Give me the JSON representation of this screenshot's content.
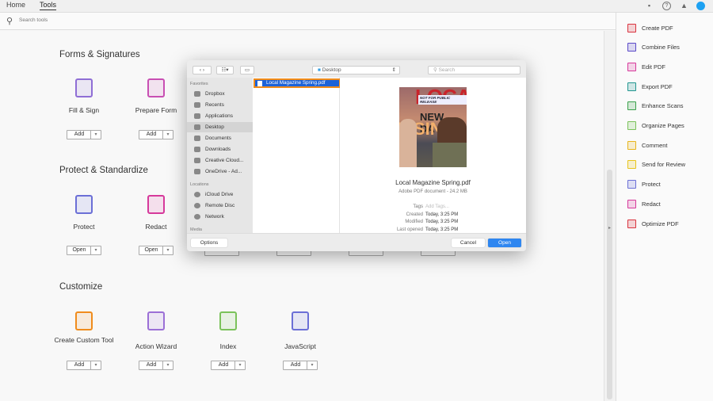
{
  "topbar": {
    "tabs": [
      "Home",
      "Tools"
    ],
    "active": "Tools"
  },
  "search": {
    "placeholder": "Search tools"
  },
  "sections": [
    {
      "title": "Forms & Signatures",
      "tools": [
        {
          "label": "Fill & Sign",
          "button": "Add",
          "icon": "fill-sign-icon",
          "color": "#8f6ed5"
        },
        {
          "label": "Prepare Form",
          "button": "Add",
          "icon": "prepare-form-icon",
          "color": "#c84fb3"
        }
      ]
    },
    {
      "title": "Protect & Standardize",
      "tools": [
        {
          "label": "Protect",
          "button": "Open",
          "icon": "shield-icon",
          "color": "#6b6fd6"
        },
        {
          "label": "Redact",
          "button": "Open",
          "icon": "redact-icon",
          "color": "#d6399b"
        }
      ]
    },
    {
      "title": "Customize",
      "tools": [
        {
          "label": "Create Custom Tool",
          "button": "Add",
          "icon": "custom-tool-icon",
          "color": "#f08c1c"
        },
        {
          "label": "Action Wizard",
          "button": "Add",
          "icon": "action-wizard-icon",
          "color": "#9b6fd6"
        },
        {
          "label": "Index",
          "button": "Add",
          "icon": "index-icon",
          "color": "#7ac25a"
        },
        {
          "label": "JavaScript",
          "button": "Add",
          "icon": "javascript-icon",
          "color": "#6b6fd6"
        }
      ]
    }
  ],
  "right_panel": [
    {
      "label": "Create PDF",
      "color": "#d9323e"
    },
    {
      "label": "Combine Files",
      "color": "#5a49c8"
    },
    {
      "label": "Edit PDF",
      "color": "#d6399b"
    },
    {
      "label": "Export PDF",
      "color": "#21968f"
    },
    {
      "label": "Enhance Scans",
      "color": "#3aa14b"
    },
    {
      "label": "Organize Pages",
      "color": "#7ac25a"
    },
    {
      "label": "Comment",
      "color": "#e8b51c"
    },
    {
      "label": "Send for Review",
      "color": "#e8c41c"
    },
    {
      "label": "Protect",
      "color": "#6b6fd6"
    },
    {
      "label": "Redact",
      "color": "#d6399b"
    },
    {
      "label": "Optimize PDF",
      "color": "#d9323e"
    }
  ],
  "dialog": {
    "location": "Desktop",
    "search_placeholder": "Search",
    "favorites_heading": "Favorites",
    "favorites": [
      "Dropbox",
      "Recents",
      "Applications",
      "Desktop",
      "Documents",
      "Downloads",
      "Creative Cloud...",
      "OneDrive - Ad..."
    ],
    "selected_favorite": "Desktop",
    "locations_heading": "Locations",
    "locations": [
      "iCloud Drive",
      "Remote Disc",
      "Network"
    ],
    "media_heading": "Media",
    "file": "Local Magazine Spring.pdf",
    "cover": {
      "masthead": "LOCAL",
      "banner": "NOT FOR PUBLIC RELEASE",
      "headline1": "NEW DAY",
      "headline2": "RISING"
    },
    "preview_name": "Local Magazine Spring.pdf",
    "preview_kind": "Adobe PDF document - 24.2 MB",
    "meta": [
      {
        "k": "Tags",
        "v": "Add Tags..."
      },
      {
        "k": "Created",
        "v": "Today, 3:25 PM"
      },
      {
        "k": "Modified",
        "v": "Today, 3:25 PM"
      },
      {
        "k": "Last opened",
        "v": "Today, 3:25 PM"
      }
    ],
    "options": "Options",
    "cancel": "Cancel",
    "open": "Open"
  }
}
